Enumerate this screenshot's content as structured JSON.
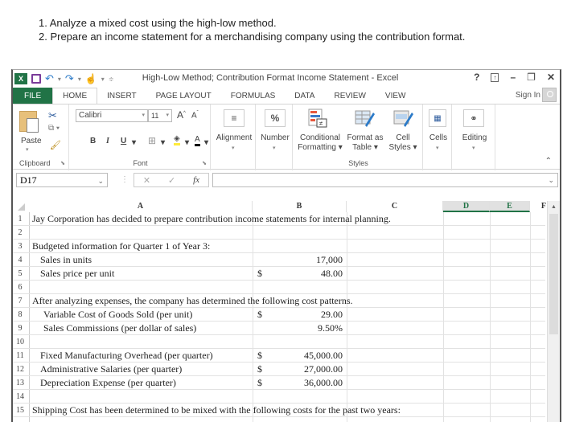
{
  "instructions": [
    "1. Analyze a mixed cost using the high-low method.",
    "2. Prepare an income statement for a merchandising company using the contribution format."
  ],
  "window": {
    "title": "High-Low Method; Contribution Format Income Statement - Excel",
    "help": "?",
    "sign_in": "Sign In"
  },
  "tabs": [
    "FILE",
    "HOME",
    "INSERT",
    "PAGE LAYOUT",
    "FORMULAS",
    "DATA",
    "REVIEW",
    "VIEW"
  ],
  "active_tab": "HOME",
  "ribbon": {
    "clipboard": {
      "paste": "Paste",
      "label": "Clipboard"
    },
    "font": {
      "name": "Calibri",
      "size": "11",
      "bold": "B",
      "italic": "I",
      "underline": "U",
      "label": "Font"
    },
    "alignment": {
      "label": "Alignment"
    },
    "number": {
      "label": "Number",
      "icon_text": "%"
    },
    "styles": {
      "conditional_formatting": [
        "Conditional",
        "Formatting ▾"
      ],
      "format_as_table": [
        "Format as",
        "Table ▾"
      ],
      "cell_styles": [
        "Cell",
        "Styles ▾"
      ],
      "label": "Styles"
    },
    "cells": {
      "label": "Cells"
    },
    "editing": {
      "label": "Editing"
    }
  },
  "formula_bar": {
    "name_box": "D17",
    "fx": "fx",
    "formula": ""
  },
  "columns": [
    "A",
    "B",
    "C",
    "D",
    "E",
    "F"
  ],
  "selected_columns": [
    "D",
    "E"
  ],
  "rows": [
    {
      "n": "1",
      "a": "Jay Corporation  has decided to prepare contribution income statements for internal planning.",
      "indent": 0,
      "b_sym": "",
      "b_val": ""
    },
    {
      "n": "2",
      "a": "",
      "indent": 0,
      "b_sym": "",
      "b_val": ""
    },
    {
      "n": "3",
      "a": "Budgeted information for Quarter 1 of Year 3:",
      "indent": 0,
      "b_sym": "",
      "b_val": ""
    },
    {
      "n": "4",
      "a": "Sales in units",
      "indent": 1,
      "b_sym": "",
      "b_val": "17,000"
    },
    {
      "n": "5",
      "a": "Sales price per unit",
      "indent": 1,
      "b_sym": "$",
      "b_val": "48.00"
    },
    {
      "n": "6",
      "a": "",
      "indent": 0,
      "b_sym": "",
      "b_val": ""
    },
    {
      "n": "7",
      "a": "After analyzing expenses, the company has determined the following cost patterns.",
      "indent": 0,
      "b_sym": "",
      "b_val": ""
    },
    {
      "n": "8",
      "a": "Variable Cost of Goods Sold (per unit)",
      "indent": 2,
      "b_sym": "$",
      "b_val": "29.00"
    },
    {
      "n": "9",
      "a": "Sales Commissions (per dollar of sales)",
      "indent": 2,
      "b_sym": "",
      "b_val": "9.50%"
    },
    {
      "n": "10",
      "a": "",
      "indent": 0,
      "b_sym": "",
      "b_val": ""
    },
    {
      "n": "11",
      "a": "Fixed Manufacturing Overhead (per quarter)",
      "indent": 1,
      "b_sym": "$",
      "b_val": "45,000.00"
    },
    {
      "n": "12",
      "a": "Administrative Salaries (per quarter)",
      "indent": 1,
      "b_sym": "$",
      "b_val": "27,000.00"
    },
    {
      "n": "13",
      "a": "Depreciation Expense (per quarter)",
      "indent": 1,
      "b_sym": "$",
      "b_val": "36,000.00"
    },
    {
      "n": "14",
      "a": "",
      "indent": 0,
      "b_sym": "",
      "b_val": ""
    },
    {
      "n": "15",
      "a": "Shipping Cost has been determined to be mixed with the following costs for the past two years:",
      "indent": 0,
      "b_sym": "",
      "b_val": ""
    }
  ]
}
